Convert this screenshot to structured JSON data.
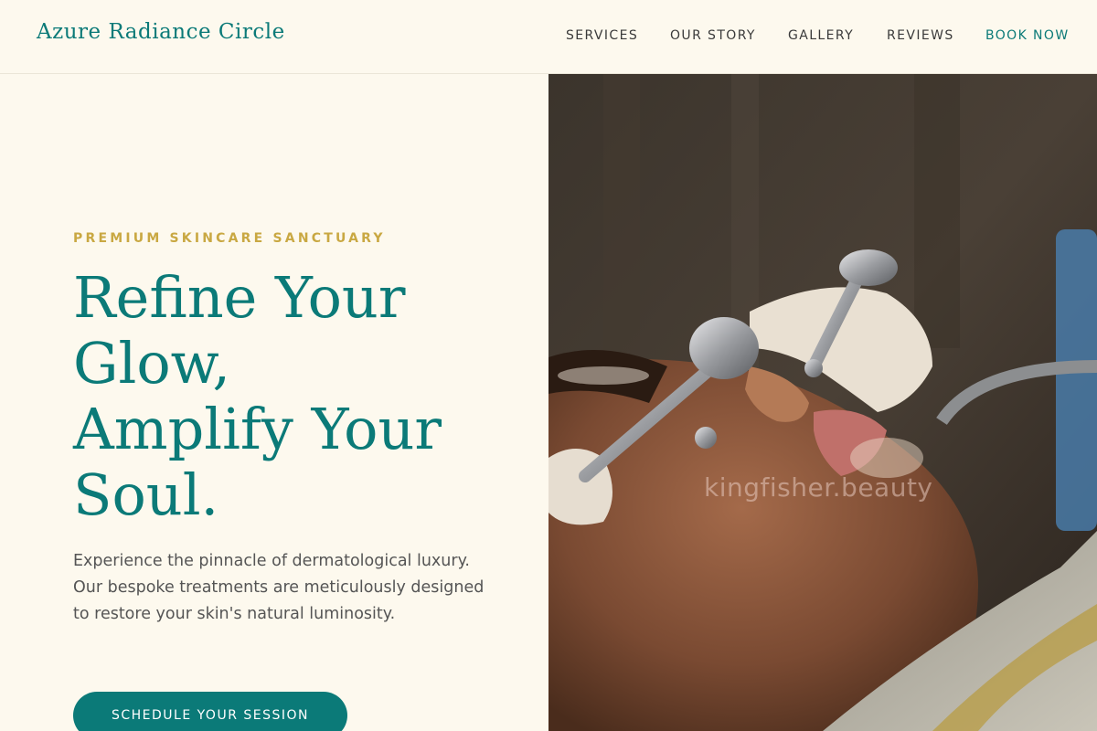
{
  "brand": {
    "name": "Azure Radiance Circle"
  },
  "nav": {
    "items": [
      {
        "label": "SERVICES"
      },
      {
        "label": "OUR STORY"
      },
      {
        "label": "GALLERY"
      },
      {
        "label": "REVIEWS"
      },
      {
        "label": "BOOK NOW"
      }
    ]
  },
  "hero": {
    "eyebrow": "PREMIUM SKINCARE SANCTUARY",
    "headline_lines": [
      "Refine Your",
      "Glow,",
      "Amplify Your",
      "Soul."
    ],
    "description": "Experience the pinnacle of dermatological luxury. Our bespoke treatments are meticulously designed to restore your skin's natural luminosity.",
    "cta_label": "SCHEDULE YOUR SESSION",
    "image_watermark": "kingfisher.beauty"
  },
  "colors": {
    "accent": "#0b7a78",
    "gold": "#c9a842",
    "background": "#fdf9ee"
  }
}
